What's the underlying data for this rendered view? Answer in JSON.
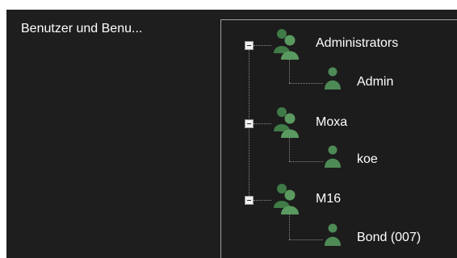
{
  "left_panel": {
    "label": "Benutzer und Benu..."
  },
  "tree": {
    "groups": [
      {
        "label": "Administrators",
        "icon": "user-group-icon",
        "users": [
          {
            "label": "Admin",
            "icon": "user-icon"
          }
        ]
      },
      {
        "label": "Moxa",
        "icon": "user-group-icon",
        "users": [
          {
            "label": "koe",
            "icon": "user-icon"
          }
        ]
      },
      {
        "label": "M16",
        "icon": "user-group-icon",
        "users": [
          {
            "label": "Bond (007)",
            "icon": "user-icon"
          }
        ]
      }
    ],
    "colors": {
      "icon_green": "#4e8a55",
      "icon_green_light": "#6aa66f",
      "background": "#1e1e1e",
      "text": "#ffffff"
    }
  }
}
